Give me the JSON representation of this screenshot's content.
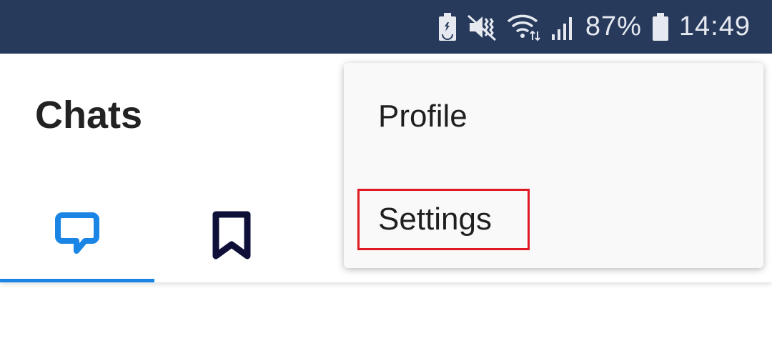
{
  "status_bar": {
    "battery_percent": "87%",
    "time": "14:49",
    "icons": [
      "battery-saver-icon",
      "vibrate-mute-icon",
      "wifi-icon",
      "signal-icon",
      "battery-icon"
    ]
  },
  "header": {
    "title": "Chats"
  },
  "tabs": [
    {
      "name": "chats",
      "icon": "chat-bubble-icon",
      "selected": true,
      "color": "#1b85e5"
    },
    {
      "name": "saved",
      "icon": "bookmark-icon",
      "selected": false,
      "color": "#0e1038"
    }
  ],
  "menu": {
    "items": [
      {
        "label": "Profile"
      },
      {
        "label": "Settings",
        "highlighted": true
      }
    ]
  },
  "colors": {
    "status_bar_bg": "#273a5c",
    "accent": "#1b85e5",
    "highlight": "#e01a24"
  }
}
